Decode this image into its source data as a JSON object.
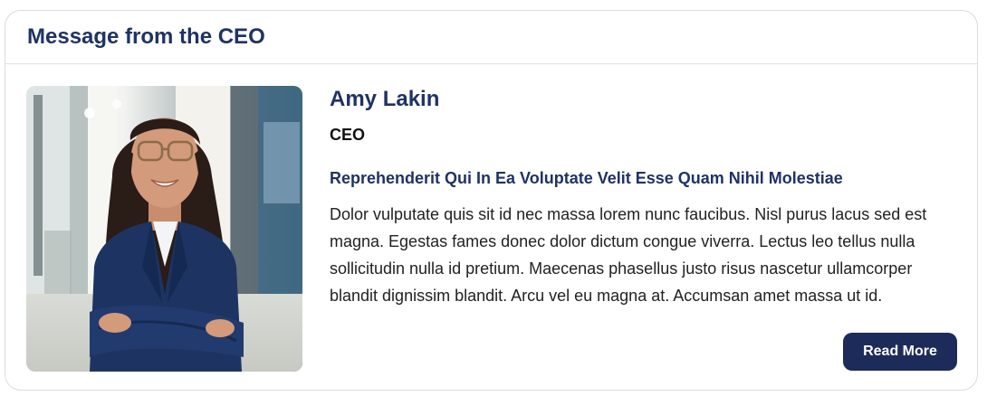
{
  "card": {
    "title": "Message from the CEO"
  },
  "profile": {
    "photo_icon": "ceo-portrait-photo",
    "name": "Amy Lakin",
    "role": "CEO"
  },
  "message": {
    "title": "Reprehenderit Qui In Ea Voluptate Velit Esse Quam Nihil Molestiae",
    "body": "Dolor vulputate quis sit id nec massa lorem nunc faucibus. Nisl purus lacus sed est magna. Egestas fames donec dolor dictum congue viverra. Lectus leo tellus nulla sollicitudin nulla id pretium. Maecenas phasellus justo risus nascetur ullamcorper blandit dignissim blandit. Arcu vel eu magna at. Accumsan amet massa ut id."
  },
  "actions": {
    "read_more_label": "Read More"
  },
  "colors": {
    "heading": "#1f3364",
    "button_bg": "#1c2b5a",
    "border": "#d9dce3"
  }
}
